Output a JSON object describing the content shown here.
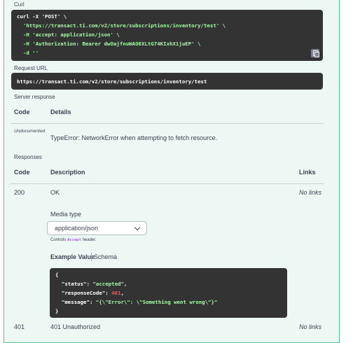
{
  "curl_section": {
    "label": "Curl",
    "lines": [
      "curl -X 'POST' \\",
      "  'https://transact.ti.com/v2/store/subscriptions/inventory/test' \\",
      "  -H 'accept: application/json' \\",
      "  -H 'Authorization: Bearer dwOajfnuWAO6XLtG74KIxhX1juEP' \\",
      "  -d ''"
    ]
  },
  "request_url": {
    "label": "Request URL",
    "value": "https://transact.ti.com/v2/store/subscriptions/inventory/test"
  },
  "server_response": {
    "label": "Server response",
    "col_code": "Code",
    "col_details": "Details",
    "row_code": "Undocumented",
    "row_details": "TypeError: NetworkError when attempting to fetch resource."
  },
  "responses": {
    "label": "Responses",
    "col_code": "Code",
    "col_description": "Description",
    "col_links": "Links",
    "rows": [
      {
        "code": "200",
        "description": "OK",
        "links": "No links"
      },
      {
        "code": "401",
        "description": "401 Unauthorized",
        "links": "No links"
      }
    ],
    "media_type_label": "Media type",
    "media_type_value": "application/json",
    "controls_prefix": "Controls",
    "controls_code": "Accept",
    "controls_suffix": "header.",
    "tab_example": "Example Value",
    "tab_schema": "Schema",
    "example_json": {
      "open": "{",
      "k1": "\"status\"",
      "v1": "\"accepted\"",
      "k2": "\"responseCode\"",
      "v2": "401",
      "k3": "\"message\"",
      "v3": "\"{\\\"Error\\\": \\\"Something went wrong\\\"}\"",
      "close": "}"
    }
  }
}
